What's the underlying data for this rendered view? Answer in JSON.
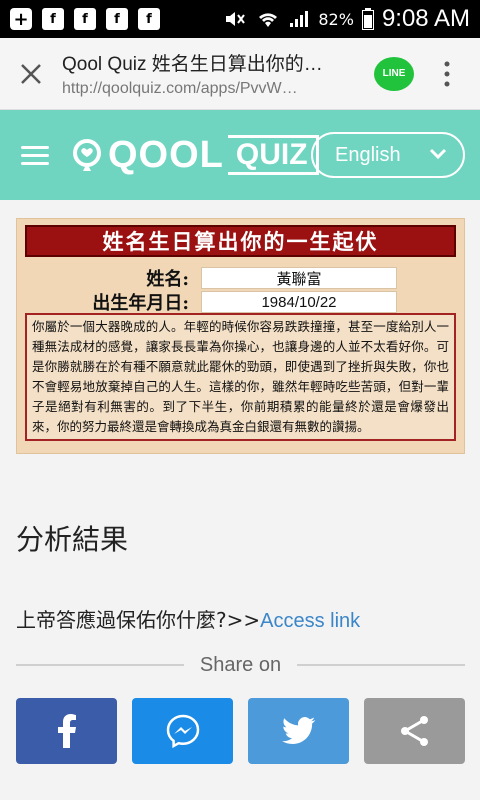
{
  "status_bar": {
    "battery": "82%",
    "time": "9:08 AM",
    "notif_icons": [
      "plus-box-icon",
      "facebook-icon",
      "facebook-icon",
      "facebook-icon",
      "facebook-icon"
    ]
  },
  "browser": {
    "title": "Qool Quiz 姓名生日算出你的…",
    "url": "http://qoolquiz.com/apps/PvvW…",
    "line_label": "LINE"
  },
  "header": {
    "logo_q": "QOOL",
    "logo_box": "QUIZ",
    "language": "English",
    "colors": {
      "header_bg": "#6fd5c1"
    }
  },
  "result_card": {
    "banner": "姓名生日算出你的一生起伏",
    "name_label": "姓名:",
    "name_value": "黃聯富",
    "dob_label": "出生年月日:",
    "dob_value": "1984/10/22",
    "body": "你屬於一個大器晚成的人。年輕的時候你容易跌跌撞撞，甚至一度給別人一種無法成材的感覺，讓家長長輩為你操心，也讓身邊的人並不太看好你。可是你勝就勝在於有種不願意就此罷休的勁頭，即使遇到了挫折與失敗，你也不會輕易地放棄掉自己的人生。這樣的你，雖然年輕時吃些苦頭，但對一輩子是絕對有利無害的。到了下半生，你前期積累的能量終於還是會爆發出來，你的努力最終還是會轉換成為真金白銀還有無數的讚揚。"
  },
  "analysis": {
    "title": "分析結果",
    "access_prefix": "上帝答應過保佑你什麼?>>",
    "access_link": "Access link"
  },
  "share": {
    "label": "Share on",
    "buttons": [
      "facebook",
      "messenger",
      "twitter",
      "share"
    ]
  }
}
